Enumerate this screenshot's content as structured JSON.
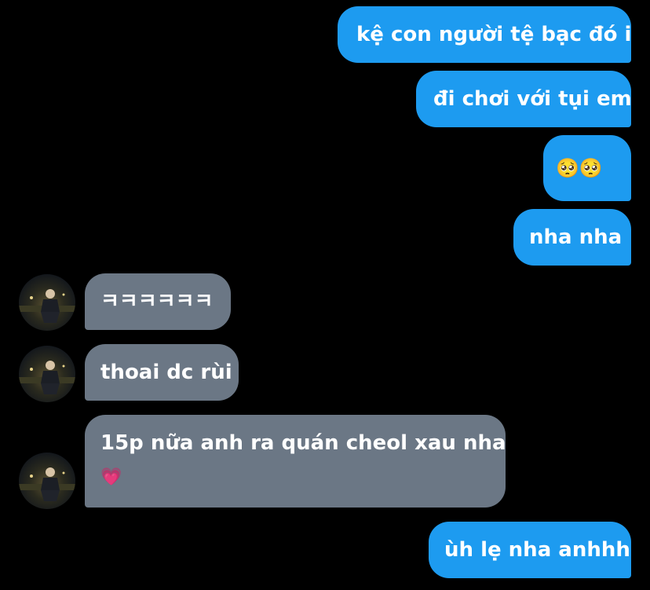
{
  "messages": [
    {
      "side": "out",
      "text": "kệ con người tệ bạc đó i"
    },
    {
      "side": "out",
      "text": "đi chơi với tụi em"
    },
    {
      "side": "out",
      "text": "🥺🥺"
    },
    {
      "side": "out",
      "text": "nha nha"
    },
    {
      "side": "in",
      "text": "ㅋㅋㅋㅋㅋㅋ"
    },
    {
      "side": "in",
      "text": "thoai dc rùi"
    },
    {
      "side": "in",
      "text": "15p nữa anh ra quán cheol xau nha",
      "emoji": "💗"
    },
    {
      "side": "out",
      "text": "ùh lẹ nha anhhh"
    }
  ],
  "colors": {
    "background": "#000000",
    "outgoing_bubble": "#1d9bf0",
    "incoming_bubble": "#6b7785",
    "text": "#ffffff"
  },
  "icons": {
    "avatar": "avatar-photo"
  }
}
